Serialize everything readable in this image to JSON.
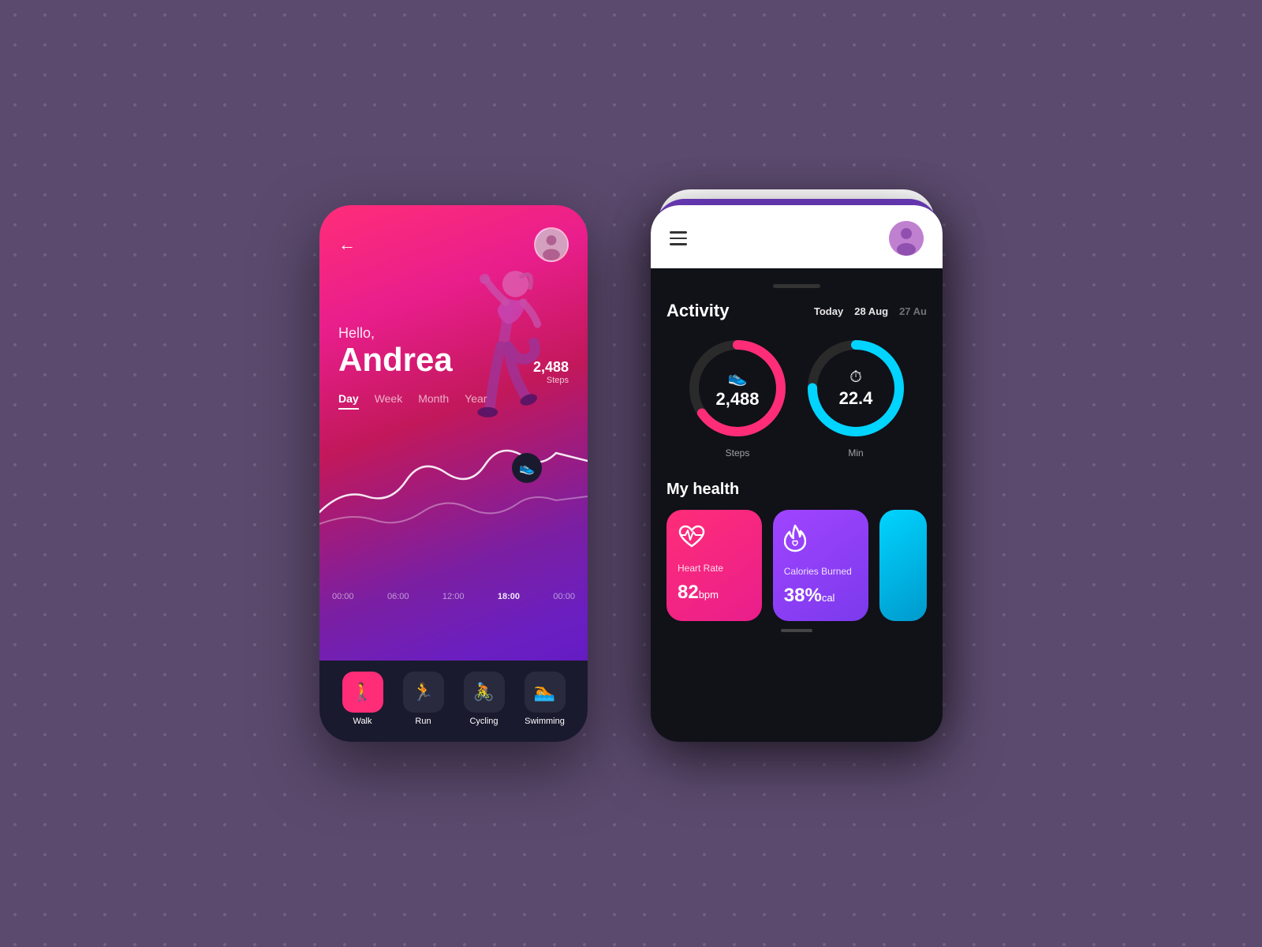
{
  "background": {
    "color": "#5c4a6e"
  },
  "phone1": {
    "greeting_hello": "Hello,",
    "greeting_name": "Andrea",
    "tabs": [
      {
        "label": "Day",
        "active": true
      },
      {
        "label": "Week",
        "active": false
      },
      {
        "label": "Month",
        "active": false
      },
      {
        "label": "Year",
        "active": false
      }
    ],
    "steps_value": "2,488",
    "steps_label": "Steps",
    "time_labels": [
      "00:00",
      "06:00",
      "12:00",
      "18:00",
      "00:00"
    ],
    "nav_items": [
      {
        "label": "Walk",
        "active": true,
        "icon": "🚶"
      },
      {
        "label": "Run",
        "active": false,
        "icon": "🏃"
      },
      {
        "label": "Cycling",
        "active": false,
        "icon": "🚴"
      },
      {
        "label": "Swimming",
        "active": false,
        "icon": "🏊"
      }
    ]
  },
  "phone2": {
    "activity_title": "Activity",
    "dates": [
      {
        "label": "Today",
        "dimmed": false
      },
      {
        "label": "28 Aug",
        "dimmed": false
      },
      {
        "label": "27 Au",
        "dimmed": true
      }
    ],
    "rings": [
      {
        "label": "Steps",
        "value": "2,488",
        "icon": "👟",
        "color": "#ff2d78",
        "track_color": "#2a2a2a",
        "percent": 65
      },
      {
        "label": "Min",
        "value": "22.4",
        "icon": "⏱",
        "color": "#00d4ff",
        "track_color": "#2a2a2a",
        "percent": 75
      }
    ],
    "my_health_title": "My health",
    "health_cards": [
      {
        "label": "Heart Rate",
        "value": "82",
        "unit": "bpm",
        "color_class": "pink",
        "icon": "❤️"
      },
      {
        "label": "Calories Burned",
        "value": "38%",
        "unit": "cal",
        "color_class": "purple",
        "icon": "🔥"
      }
    ]
  }
}
